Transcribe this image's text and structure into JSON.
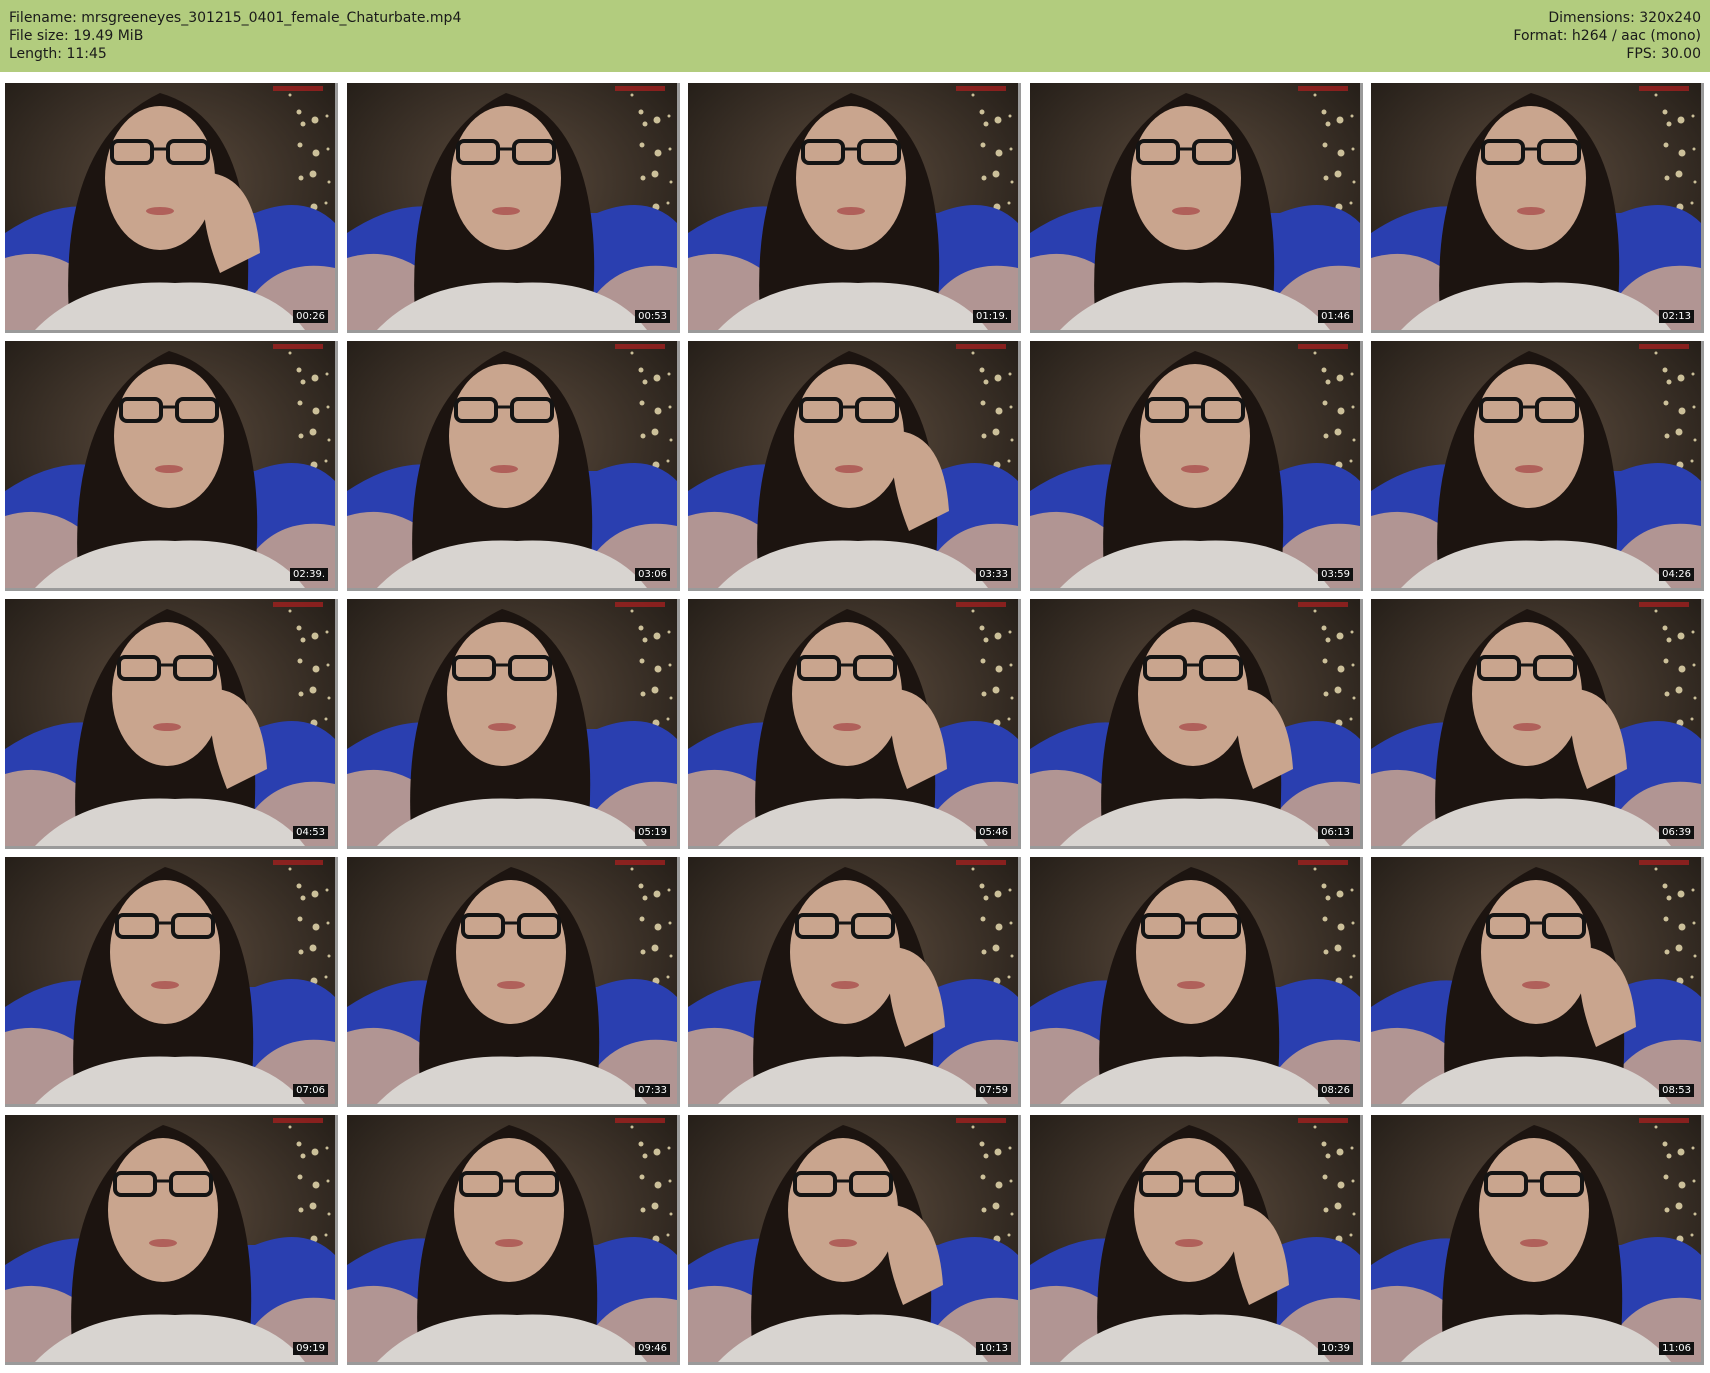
{
  "header": {
    "filename": "Filename: mrsgreeneyes_301215_0401_female_Chaturbate.mp4",
    "filesize": "File size: 19.49 MiB",
    "length": "Length: 11:45",
    "dimensions": "Dimensions: 320x240",
    "format": "Format: h264 / aac (mono)",
    "fps": "FPS: 30.00"
  },
  "colors": {
    "header_bg": "#b2cc7e",
    "shirt": "#2a3fb0",
    "skin": "#c9a58e",
    "hair": "#1c1410",
    "pillow": "#d8d4d0"
  },
  "thumbnails": [
    {
      "timestamp": "00:26",
      "hand": true
    },
    {
      "timestamp": "00:53",
      "hand": false
    },
    {
      "timestamp": "01:19.",
      "hand": false
    },
    {
      "timestamp": "01:46",
      "hand": false
    },
    {
      "timestamp": "02:13",
      "hand": false
    },
    {
      "timestamp": "02:39.",
      "hand": false
    },
    {
      "timestamp": "03:06",
      "hand": false
    },
    {
      "timestamp": "03:33",
      "hand": true
    },
    {
      "timestamp": "03:59",
      "hand": false
    },
    {
      "timestamp": "04:26",
      "hand": false
    },
    {
      "timestamp": "04:53",
      "hand": true
    },
    {
      "timestamp": "05:19",
      "hand": false
    },
    {
      "timestamp": "05:46",
      "hand": true
    },
    {
      "timestamp": "06:13",
      "hand": true
    },
    {
      "timestamp": "06:39",
      "hand": true
    },
    {
      "timestamp": "07:06",
      "hand": false
    },
    {
      "timestamp": "07:33",
      "hand": false
    },
    {
      "timestamp": "07:59",
      "hand": true
    },
    {
      "timestamp": "08:26",
      "hand": false
    },
    {
      "timestamp": "08:53",
      "hand": true
    },
    {
      "timestamp": "09:19",
      "hand": false
    },
    {
      "timestamp": "09:46",
      "hand": false
    },
    {
      "timestamp": "10:13",
      "hand": true
    },
    {
      "timestamp": "10:39",
      "hand": true
    },
    {
      "timestamp": "11:06",
      "hand": false
    }
  ]
}
